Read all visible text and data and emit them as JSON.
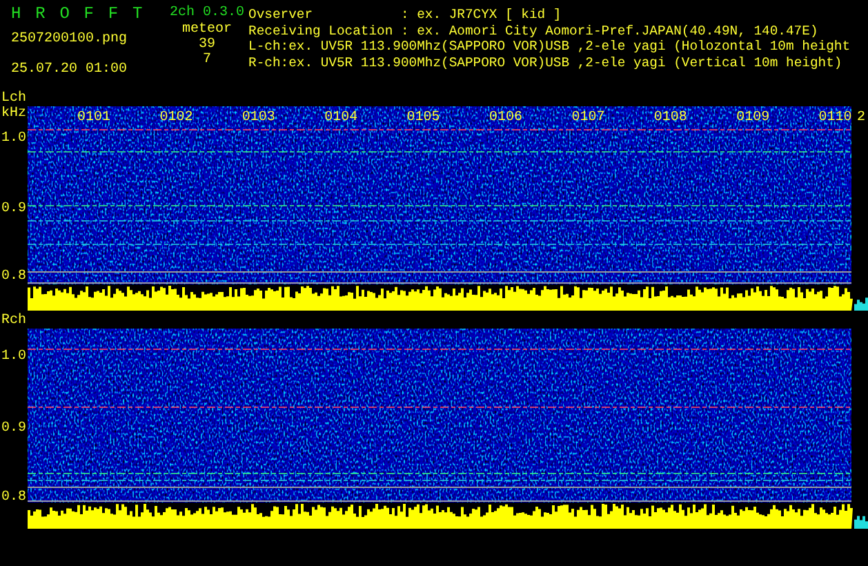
{
  "header": {
    "title": "H R O F F T",
    "version": "2ch 0.3.0",
    "filename": "2507200100.png",
    "datetime": "25.07.20 01:00",
    "count_label": "meteor",
    "counts": [
      "39",
      "7"
    ],
    "info": [
      {
        "kind": "field",
        "label": "Ovserver",
        "value": ": ex. JR7CYX [ kid ]"
      },
      {
        "kind": "field",
        "label": "Receiving Location",
        "value": ": ex. Aomori City Aomori-Pref.JAPAN(40.49N, 140.47E)"
      },
      {
        "kind": "line",
        "label": "L-ch:",
        "value": "ex. UV5R 113.900Mhz(SAPPORO VOR)USB ,2-ele yagi (Holozontal 10m height"
      },
      {
        "kind": "line",
        "label": "R-ch:",
        "value": "ex. UV5R 113.900Mhz(SAPPORO VOR)USB ,2-ele yagi (Vertical 10m height)"
      }
    ]
  },
  "panels": [
    {
      "label": "Lch",
      "unit": "kHz",
      "yticks": [
        "1.0",
        "0.9",
        "0.8"
      ],
      "time_labels": [
        "0101",
        "0102",
        "0103",
        "0104",
        "0105",
        "0106",
        "0107",
        "0108",
        "0109",
        "0110",
        "2"
      ]
    },
    {
      "label": "Rch",
      "yticks": [
        "1.0",
        "0.9",
        "0.8"
      ]
    }
  ]
}
